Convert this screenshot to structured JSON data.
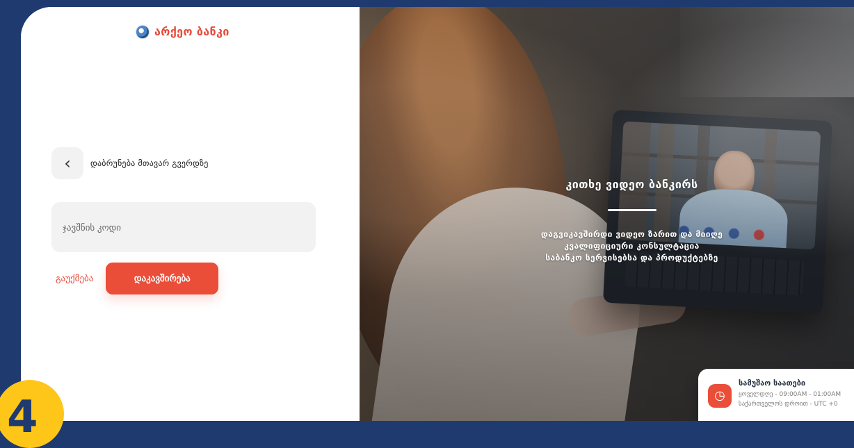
{
  "brand": {
    "logo_text": "არქეო ბანკი",
    "logo_icon": "globe-icon"
  },
  "form": {
    "back_label": "დაბრუნება მთავარ გვერდზე",
    "back_icon": "chevron-left-icon",
    "answer_code_placeholder": "ჯავშნის კოდი",
    "cancel_label": "გაუქმება",
    "connect_label": "დაკავშირება"
  },
  "hero": {
    "title": "კითხე ვიდეო ბანკირს",
    "line_1": "დაგვიკავშირდი ვიდეო ზარით და მიიღე",
    "line_2": "კვალიფიციური კონსულტაცია",
    "line_3": "საბანკო სერვისებსა და პროდუქტებზე"
  },
  "hours": {
    "title": "სამუშაო საათები",
    "line_1": "ყოველდღე - 09:00AM - 01:00AM",
    "line_2": "საქართველოს დროით - UTC +0",
    "clock_icon": "clock-icon"
  },
  "step_badge": {
    "number": "4"
  },
  "colors": {
    "primary_red": "#ea4d38",
    "brand_blue": "#1f3a6f",
    "accent_yellow": "#ffc61a"
  }
}
